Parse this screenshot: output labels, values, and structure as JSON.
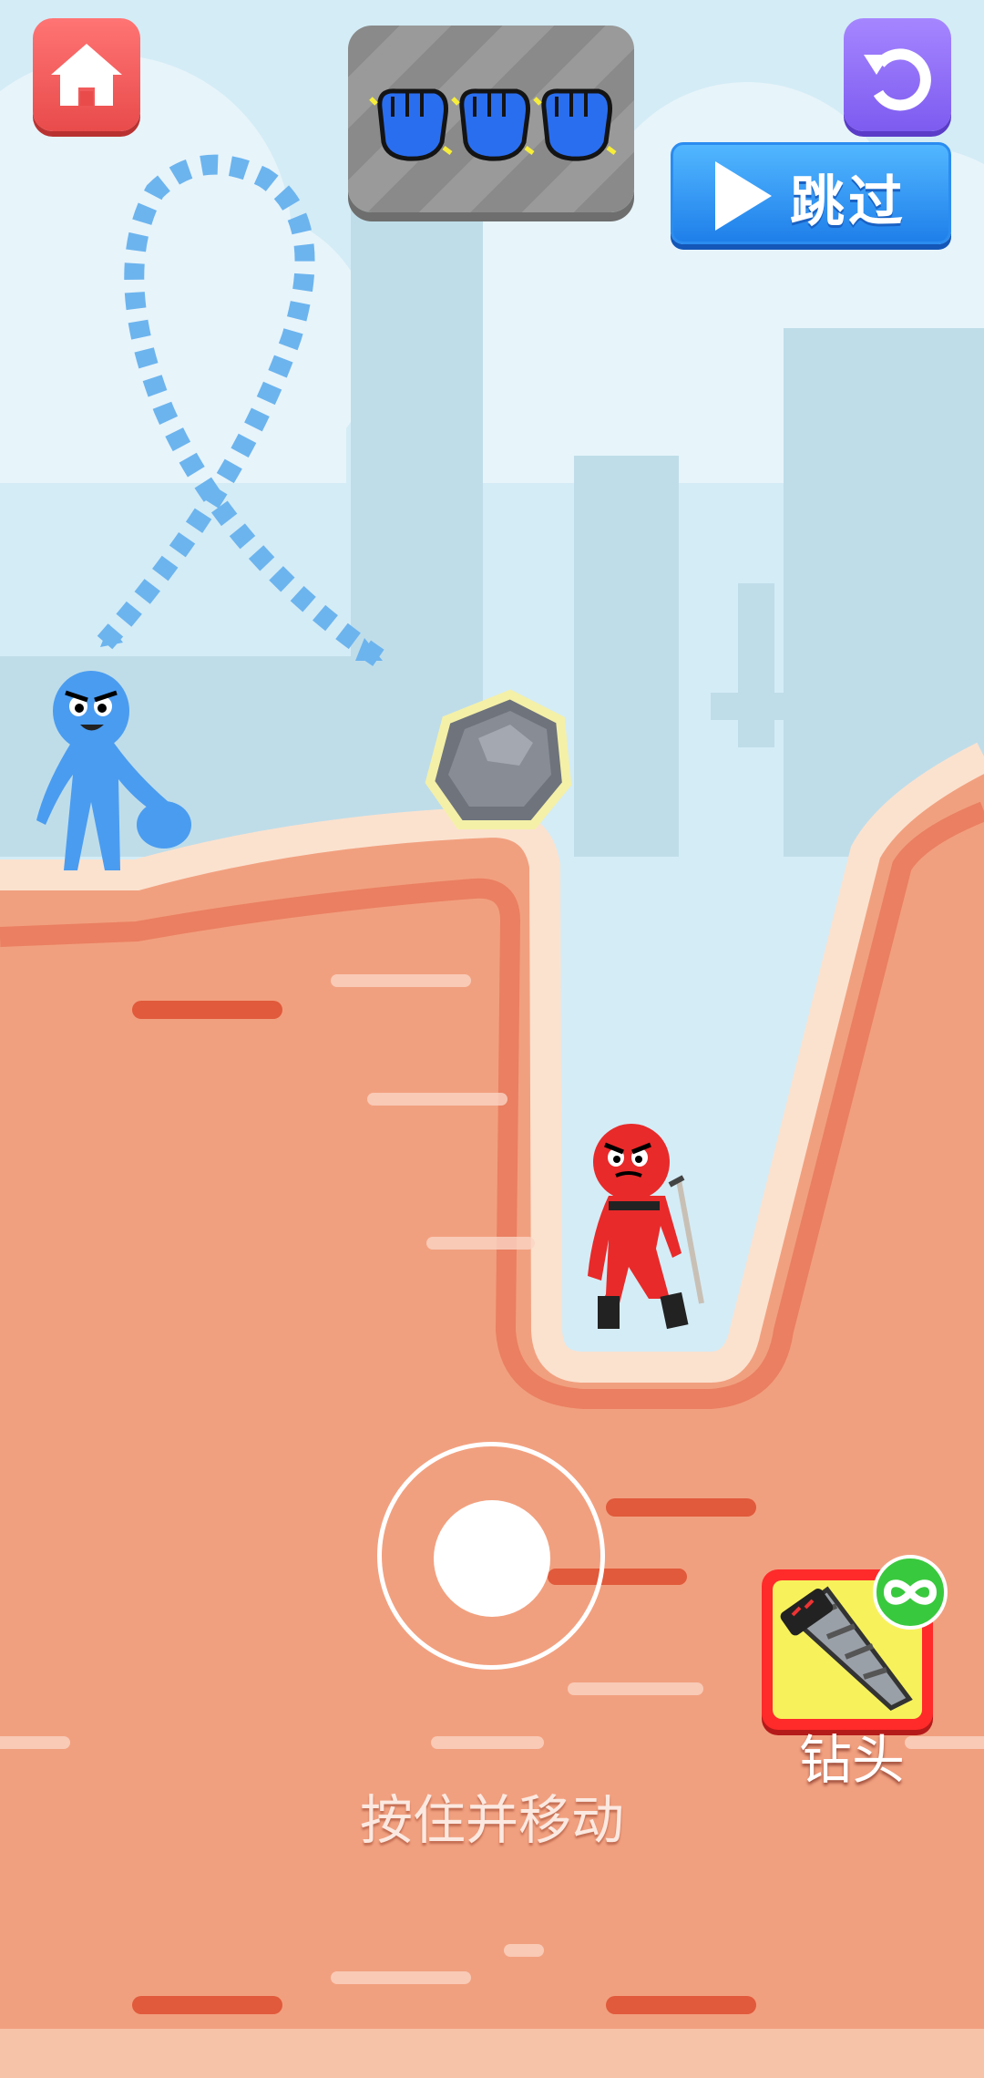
{
  "hud": {
    "skip_label": "跳过",
    "fist_count": 3
  },
  "controls": {
    "hint": "按住并移动"
  },
  "powerup": {
    "label": "钻头",
    "badge_icon": "infinity-icon"
  },
  "colors": {
    "sky": "#cfe8f3",
    "ground": "#f1a07f",
    "ground_edge": "#fbe2cf",
    "player": "#4a9cf0",
    "enemy": "#e82a2a",
    "home_button": "#f05757",
    "restart_button": "#8e6cf6",
    "skip_button": "#2f94f2",
    "trail": "#6cb4ee"
  }
}
